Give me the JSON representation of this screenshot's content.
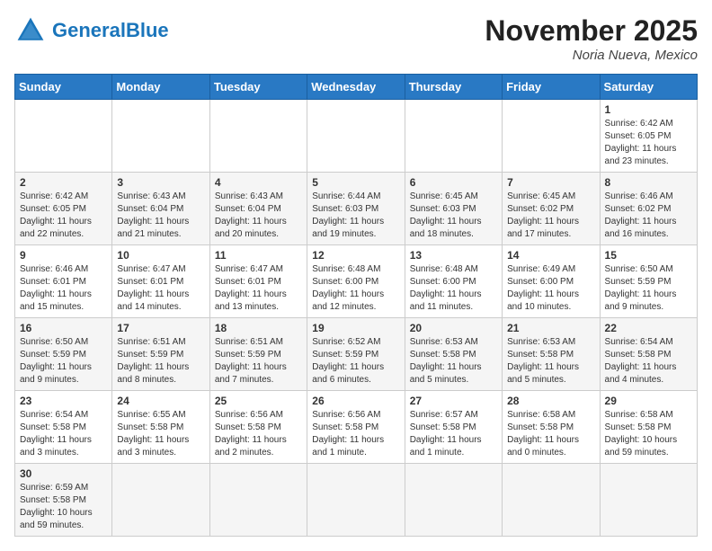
{
  "header": {
    "logo_general": "General",
    "logo_blue": "Blue",
    "month_title": "November 2025",
    "location": "Noria Nueva, Mexico"
  },
  "weekdays": [
    "Sunday",
    "Monday",
    "Tuesday",
    "Wednesday",
    "Thursday",
    "Friday",
    "Saturday"
  ],
  "days": [
    {
      "date": "",
      "info": ""
    },
    {
      "date": "",
      "info": ""
    },
    {
      "date": "",
      "info": ""
    },
    {
      "date": "",
      "info": ""
    },
    {
      "date": "",
      "info": ""
    },
    {
      "date": "",
      "info": ""
    },
    {
      "date": "1",
      "info": "Sunrise: 6:42 AM\nSunset: 6:05 PM\nDaylight: 11 hours and 23 minutes."
    },
    {
      "date": "2",
      "info": "Sunrise: 6:42 AM\nSunset: 6:05 PM\nDaylight: 11 hours and 22 minutes."
    },
    {
      "date": "3",
      "info": "Sunrise: 6:43 AM\nSunset: 6:04 PM\nDaylight: 11 hours and 21 minutes."
    },
    {
      "date": "4",
      "info": "Sunrise: 6:43 AM\nSunset: 6:04 PM\nDaylight: 11 hours and 20 minutes."
    },
    {
      "date": "5",
      "info": "Sunrise: 6:44 AM\nSunset: 6:03 PM\nDaylight: 11 hours and 19 minutes."
    },
    {
      "date": "6",
      "info": "Sunrise: 6:45 AM\nSunset: 6:03 PM\nDaylight: 11 hours and 18 minutes."
    },
    {
      "date": "7",
      "info": "Sunrise: 6:45 AM\nSunset: 6:02 PM\nDaylight: 11 hours and 17 minutes."
    },
    {
      "date": "8",
      "info": "Sunrise: 6:46 AM\nSunset: 6:02 PM\nDaylight: 11 hours and 16 minutes."
    },
    {
      "date": "9",
      "info": "Sunrise: 6:46 AM\nSunset: 6:01 PM\nDaylight: 11 hours and 15 minutes."
    },
    {
      "date": "10",
      "info": "Sunrise: 6:47 AM\nSunset: 6:01 PM\nDaylight: 11 hours and 14 minutes."
    },
    {
      "date": "11",
      "info": "Sunrise: 6:47 AM\nSunset: 6:01 PM\nDaylight: 11 hours and 13 minutes."
    },
    {
      "date": "12",
      "info": "Sunrise: 6:48 AM\nSunset: 6:00 PM\nDaylight: 11 hours and 12 minutes."
    },
    {
      "date": "13",
      "info": "Sunrise: 6:48 AM\nSunset: 6:00 PM\nDaylight: 11 hours and 11 minutes."
    },
    {
      "date": "14",
      "info": "Sunrise: 6:49 AM\nSunset: 6:00 PM\nDaylight: 11 hours and 10 minutes."
    },
    {
      "date": "15",
      "info": "Sunrise: 6:50 AM\nSunset: 5:59 PM\nDaylight: 11 hours and 9 minutes."
    },
    {
      "date": "16",
      "info": "Sunrise: 6:50 AM\nSunset: 5:59 PM\nDaylight: 11 hours and 9 minutes."
    },
    {
      "date": "17",
      "info": "Sunrise: 6:51 AM\nSunset: 5:59 PM\nDaylight: 11 hours and 8 minutes."
    },
    {
      "date": "18",
      "info": "Sunrise: 6:51 AM\nSunset: 5:59 PM\nDaylight: 11 hours and 7 minutes."
    },
    {
      "date": "19",
      "info": "Sunrise: 6:52 AM\nSunset: 5:59 PM\nDaylight: 11 hours and 6 minutes."
    },
    {
      "date": "20",
      "info": "Sunrise: 6:53 AM\nSunset: 5:58 PM\nDaylight: 11 hours and 5 minutes."
    },
    {
      "date": "21",
      "info": "Sunrise: 6:53 AM\nSunset: 5:58 PM\nDaylight: 11 hours and 5 minutes."
    },
    {
      "date": "22",
      "info": "Sunrise: 6:54 AM\nSunset: 5:58 PM\nDaylight: 11 hours and 4 minutes."
    },
    {
      "date": "23",
      "info": "Sunrise: 6:54 AM\nSunset: 5:58 PM\nDaylight: 11 hours and 3 minutes."
    },
    {
      "date": "24",
      "info": "Sunrise: 6:55 AM\nSunset: 5:58 PM\nDaylight: 11 hours and 3 minutes."
    },
    {
      "date": "25",
      "info": "Sunrise: 6:56 AM\nSunset: 5:58 PM\nDaylight: 11 hours and 2 minutes."
    },
    {
      "date": "26",
      "info": "Sunrise: 6:56 AM\nSunset: 5:58 PM\nDaylight: 11 hours and 1 minute."
    },
    {
      "date": "27",
      "info": "Sunrise: 6:57 AM\nSunset: 5:58 PM\nDaylight: 11 hours and 1 minute."
    },
    {
      "date": "28",
      "info": "Sunrise: 6:58 AM\nSunset: 5:58 PM\nDaylight: 11 hours and 0 minutes."
    },
    {
      "date": "29",
      "info": "Sunrise: 6:58 AM\nSunset: 5:58 PM\nDaylight: 10 hours and 59 minutes."
    },
    {
      "date": "30",
      "info": "Sunrise: 6:59 AM\nSunset: 5:58 PM\nDaylight: 10 hours and 59 minutes."
    },
    {
      "date": "",
      "info": ""
    },
    {
      "date": "",
      "info": ""
    },
    {
      "date": "",
      "info": ""
    },
    {
      "date": "",
      "info": ""
    },
    {
      "date": "",
      "info": ""
    },
    {
      "date": "",
      "info": ""
    }
  ]
}
